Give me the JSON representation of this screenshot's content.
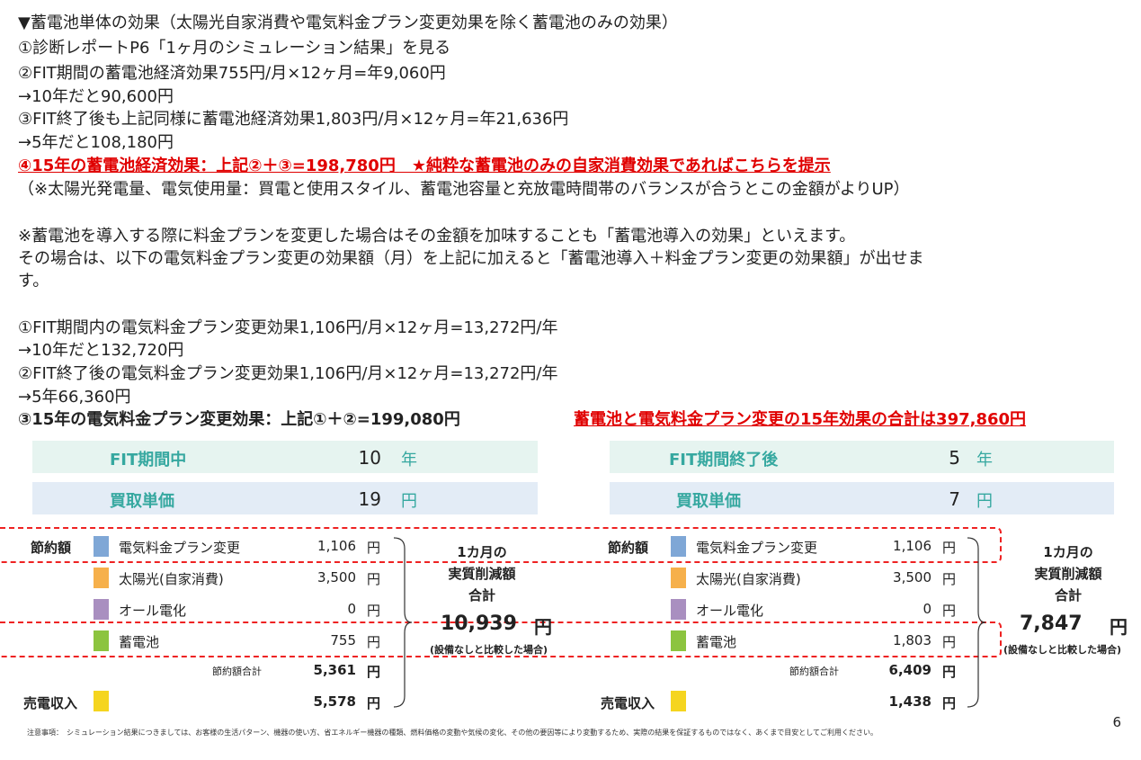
{
  "lines": [
    "▼蓄電池単体の効果（太陽光自家消費や電気料金プラン変更効果を除く蓄電池のみの効果）",
    "①診断レポートP6「1ヶ月のシミュレーション結果」を見る",
    "②FIT期間の蓄電池経済効果755円/月×12ヶ月=年9,060円",
    "→10年だと90,600円",
    "③FIT終了後も上記同様に蓄電池経済効果1,803円/月×12ヶ月=年21,636円",
    "→5年だと108,180円",
    "④15年の蓄電池経済効果：上記②＋③=198,780円　★純粋な蓄電池のみの自家消費効果であればこちらを提示",
    "（※太陽光発電量、電気使用量：買電と使用スタイル、蓄電池容量と充放電時間帯のバランスが合うとこの金額がよりUP）",
    "※蓄電池を導入する際に料金プランを変更した場合はその金額を加味することも「蓄電池導入の効果」といえます。",
    "その場合は、以下の電気料金プラン変更の効果額（月）を上記に加えると「蓄電池導入＋料金プラン変更の効果額」が出せま",
    "す。",
    "①FIT期間内の電気料金プラン変更効果1,106円/月×12ヶ月=13,272円/年",
    "→10年だと132,720円",
    "②FIT終了後の電気料金プラン変更効果1,106円/月×12ヶ月=13,272円/年",
    "→5年66,360円",
    "③15年の電気料金プラン変更効果：上記①＋②=199,080円",
    "蓄電池と電気料金プラン変更の15年効果の合計は397,860円"
  ],
  "left_panel": {
    "period_label": "FIT期間中",
    "period_value": "10",
    "period_unit": "年",
    "price_label": "買取単価",
    "price_value": "19",
    "price_unit": "円",
    "savings_label": "節約額",
    "items": [
      {
        "name": "電気料金プラン変更",
        "value": "1,106",
        "unit": "円",
        "color": "#7fa7d6"
      },
      {
        "name": "太陽光(自家消費)",
        "value": "3,500",
        "unit": "円",
        "color": "#f6b04b"
      },
      {
        "name": "オール電化",
        "value": "0",
        "unit": "円",
        "color": "#a98fc0"
      },
      {
        "name": "蓄電池",
        "value": "755",
        "unit": "円",
        "color": "#8cc43f"
      }
    ],
    "subtotal_label": "節約額合計",
    "subtotal_value": "5,361",
    "subtotal_unit": "円",
    "sale_label": "売電収入",
    "sale_value": "5,578",
    "sale_unit": "円",
    "sale_color": "#f5d51f",
    "total_title": [
      "1カ月の",
      "実質削減額",
      "合計"
    ],
    "total_value": "10,939",
    "total_unit": "円",
    "total_note": "(設備なしと比較した場合)"
  },
  "right_panel": {
    "period_label": "FIT期間終了後",
    "period_value": "5",
    "period_unit": "年",
    "price_label": "買取単価",
    "price_value": "7",
    "price_unit": "円",
    "savings_label": "節約額",
    "items": [
      {
        "name": "電気料金プラン変更",
        "value": "1,106",
        "unit": "円",
        "color": "#7fa7d6"
      },
      {
        "name": "太陽光(自家消費)",
        "value": "3,500",
        "unit": "円",
        "color": "#f6b04b"
      },
      {
        "name": "オール電化",
        "value": "0",
        "unit": "円",
        "color": "#a98fc0"
      },
      {
        "name": "蓄電池",
        "value": "1,803",
        "unit": "円",
        "color": "#8cc43f"
      }
    ],
    "subtotal_label": "節約額合計",
    "subtotal_value": "6,409",
    "subtotal_unit": "円",
    "sale_label": "売電収入",
    "sale_value": "1,438",
    "sale_unit": "円",
    "sale_color": "#f5d51f",
    "total_title": [
      "1カ月の",
      "実質削減額",
      "合計"
    ],
    "total_value": "7,847",
    "total_unit": "円",
    "total_note": "(設備なしと比較した場合)"
  },
  "footnote": "注意事項：　シミュレーション結果につきましては、お客様の生活パターン、機器の使い方、省エネルギー機器の種類、燃料価格の変動や気候の変化、その他の要因等により変動するため、実際の結果を保証するものではなく、あくまで目安としてご利用ください。",
  "page_number": "6"
}
